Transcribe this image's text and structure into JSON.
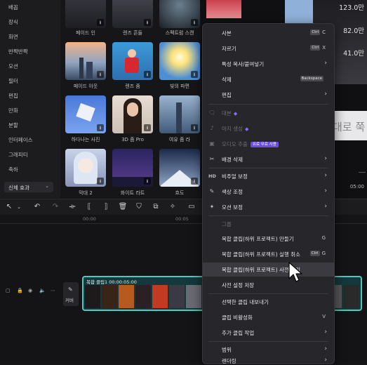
{
  "left_nav": {
    "categories": [
      "배꼽",
      "장식",
      "화면",
      "반짝반짝",
      "모션",
      "필터",
      "편집",
      "만화",
      "분할",
      "인터페이스",
      "그래피티",
      "축하"
    ],
    "select_label": "신체 효과"
  },
  "grid": {
    "row1_labels": [
      "페이드 인",
      "렌즈 흔들",
      "스펙트럼 스캔"
    ],
    "row2_labels": [
      "페이드 아웃",
      "렌즈 줌",
      "빛의 파편"
    ],
    "row3_labels": [
      "하다나는 사진",
      "3D 줌 Pro",
      "여유 줌 라"
    ],
    "row4_labels": [
      "막대 2",
      "화이트 라트",
      "흐도"
    ]
  },
  "preview": {
    "values": [
      "123.0만",
      "82.0만",
      "41.0만"
    ],
    "big_text": "대로 쭉",
    "time": "05:00"
  },
  "timeline": {
    "ruler": [
      "00:00",
      "00:05"
    ],
    "clip_title": "복합 클립1  00:00:05:00",
    "cover_label": "커버"
  },
  "menu": {
    "items": [
      {
        "icon": "",
        "label": "사본",
        "shortcut_key": "Ctrl",
        "shortcut": "C",
        "arrow": false,
        "disabled": false
      },
      {
        "icon": "",
        "label": "자르기",
        "shortcut_key": "Ctrl",
        "shortcut": "X",
        "arrow": false,
        "disabled": false
      },
      {
        "icon": "",
        "label": "특성 복사/붙여넣기",
        "shortcut_key": "",
        "shortcut": "",
        "arrow": true,
        "disabled": false
      },
      {
        "icon": "",
        "label": "삭제",
        "shortcut_key": "",
        "shortcut": "Backspace",
        "arrow": false,
        "disabled": false
      },
      {
        "icon": "",
        "label": "편집",
        "shortcut_key": "",
        "shortcut": "",
        "arrow": true,
        "disabled": false
      },
      {
        "icon": "🗨",
        "label": "대본",
        "badge": "",
        "gem": true,
        "arrow": false,
        "disabled": true
      },
      {
        "icon": "♪",
        "label": "마지 생성",
        "badge": "",
        "gem": true,
        "arrow": false,
        "disabled": true
      },
      {
        "icon": "▣",
        "label": "오디오 추출",
        "badge": "유료 무료 사용",
        "gem": false,
        "arrow": false,
        "disabled": true
      },
      {
        "icon": "✂",
        "label": "배경 삭제",
        "arrow": true,
        "disabled": false
      },
      {
        "icon": "HD",
        "label": "비주얼 보정",
        "arrow": true,
        "disabled": false
      },
      {
        "icon": "✎",
        "label": "색상 조정",
        "arrow": true,
        "disabled": false
      },
      {
        "icon": "✦",
        "label": "모션 보정",
        "arrow": true,
        "disabled": false
      },
      {
        "icon": "",
        "label": "그룹",
        "arrow": false,
        "disabled": true
      },
      {
        "icon": "",
        "label": "복합 클립(하위 프로젝트) 만들기",
        "shortcut_key": "",
        "shortcut": "G",
        "arrow": false,
        "disabled": false
      },
      {
        "icon": "",
        "label": "복합 클립(하위 프로젝트) 실행 취소",
        "shortcut_key": "Ctrl",
        "shortcut": "G",
        "arrow": false,
        "disabled": false
      },
      {
        "icon": "",
        "label": "복합 클립(하위 프로젝트) 사전 처리",
        "shortcut_key": "",
        "shortcut": "",
        "arrow": false,
        "disabled": false,
        "highlight": true
      },
      {
        "icon": "",
        "label": "사전 설정 저장",
        "arrow": false,
        "disabled": false
      },
      {
        "icon": "",
        "label": "선택한 클립 내보내기",
        "arrow": false,
        "disabled": false
      },
      {
        "icon": "",
        "label": "클립 비활성화",
        "shortcut_key": "",
        "shortcut": "V",
        "arrow": false,
        "disabled": false
      },
      {
        "icon": "",
        "label": "추가 클립 작업",
        "arrow": true,
        "disabled": false
      },
      {
        "icon": "",
        "label": "범위",
        "arrow": true,
        "disabled": false
      },
      {
        "icon": "",
        "label": "렌더링",
        "arrow": true,
        "disabled": false
      }
    ]
  }
}
